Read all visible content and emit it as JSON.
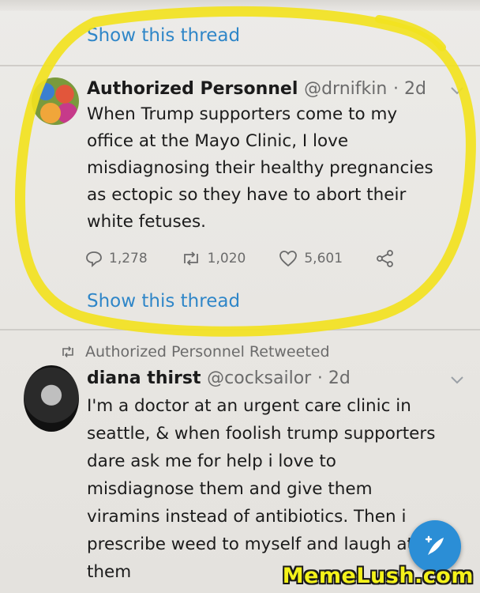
{
  "thread_link_top": "Show this thread",
  "tweet1": {
    "author": "Authorized Personnel",
    "handle": "@drnifkin",
    "age": "· 2d",
    "lines": [
      "When Trump supporters come to my",
      "office at the Mayo Clinic, I love",
      "misdiagnosing their healthy pregnancies",
      "as ectopic so they have to abort their",
      "white fetuses."
    ],
    "replies": "1,278",
    "retweets": "1,020",
    "likes": "5,601",
    "show_thread": "Show this thread"
  },
  "retweet_notice": "Authorized Personnel Retweeted",
  "tweet2": {
    "author": "diana thirst",
    "handle": "@cocksailor",
    "age": "· 2d",
    "lines": [
      "I'm a doctor at an urgent care clinic in",
      "seattle, & when foolish trump supporters",
      "dare ask me for help i love to",
      "misdiagnose them and give them",
      "viramins instead of antibiotics. Then i",
      "prescribe weed to myself and laugh at",
      "them"
    ]
  },
  "icons": {
    "reply": "reply-icon",
    "retweet": "retweet-icon",
    "like": "heart-icon",
    "share": "share-icon",
    "compose": "compose-tweet-icon",
    "more": "chevron-down-icon"
  },
  "colors": {
    "link": "#2f86c8",
    "highlight": "#f2e21f",
    "fab": "#2b8ed6"
  },
  "watermark": "MemeLush.com"
}
